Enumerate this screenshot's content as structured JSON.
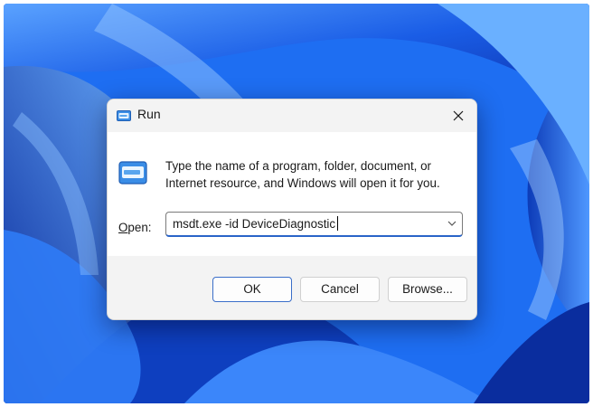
{
  "dialog": {
    "title": "Run",
    "message": "Type the name of a program, folder, document, or Internet resource, and Windows will open it for you.",
    "open_label_underlined": "O",
    "open_label_rest": "pen:",
    "open_value": "msdt.exe -id DeviceDiagnostic",
    "buttons": {
      "ok": "OK",
      "cancel": "Cancel",
      "browse": "Browse..."
    }
  },
  "icons": {
    "title": "run-icon",
    "content": "run-icon",
    "close": "close-icon",
    "dropdown": "chevron-down-icon"
  },
  "colors": {
    "wallpaper_blue": "#1b6cf0",
    "accent": "#2a64c8"
  }
}
